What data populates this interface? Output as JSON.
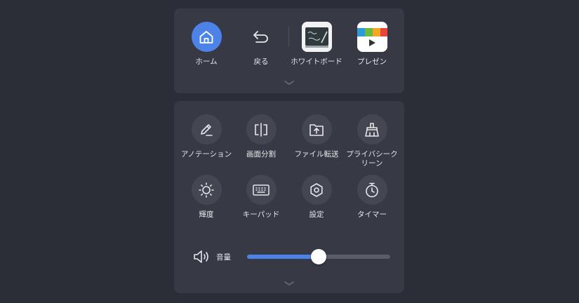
{
  "top_panel": {
    "apps": [
      {
        "label": "ホーム",
        "icon": "home-icon"
      },
      {
        "label": "戻る",
        "icon": "back-icon"
      },
      {
        "label": "ホワイトボード",
        "icon": "whiteboard-app-icon"
      },
      {
        "label": "プレゼン",
        "icon": "presentation-app-icon"
      }
    ],
    "expand_icon": "chevron-down-icon"
  },
  "tools": [
    {
      "label": "アノテーション",
      "icon": "pen-icon"
    },
    {
      "label": "画面分割",
      "icon": "split-screen-icon"
    },
    {
      "label": "ファイル転送",
      "icon": "file-upload-icon"
    },
    {
      "label": "プライバシークリーン",
      "icon": "broom-icon"
    },
    {
      "label": "輝度",
      "icon": "brightness-icon"
    },
    {
      "label": "キーパッド",
      "icon": "keyboard-icon"
    },
    {
      "label": "設定",
      "icon": "gear-icon"
    },
    {
      "label": "タイマー",
      "icon": "timer-icon"
    }
  ],
  "volume": {
    "label": "音量",
    "icon": "speaker-icon",
    "level": 0.5
  },
  "colors": {
    "accent": "#4d83e8",
    "panel": "#373a44",
    "background": "#2b2d37"
  }
}
